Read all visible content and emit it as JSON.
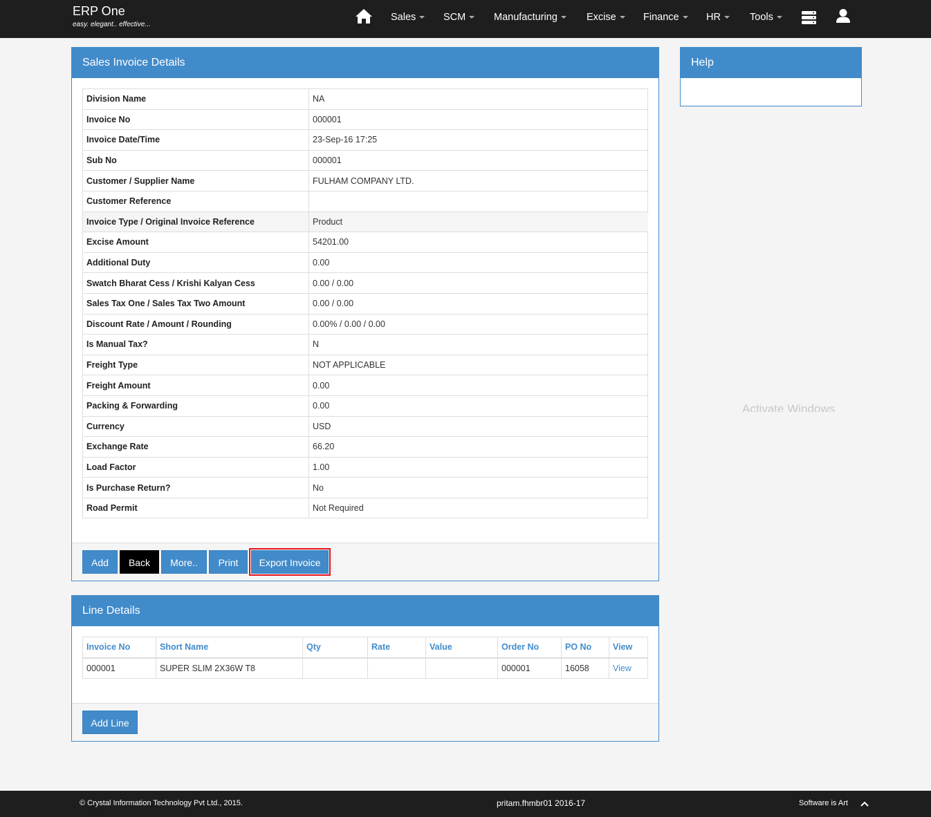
{
  "brand": {
    "title": "ERP One",
    "tagline": "easy. elegant.. effective..."
  },
  "nav": {
    "items": [
      {
        "label": "Sales"
      },
      {
        "label": "SCM"
      },
      {
        "label": "Manufacturing"
      },
      {
        "label": "Excise"
      },
      {
        "label": "Finance"
      },
      {
        "label": "HR"
      },
      {
        "label": "Tools"
      }
    ],
    "icons": [
      "home-icon",
      "server-icon",
      "user-icon"
    ]
  },
  "invoice_panel": {
    "title": "Sales Invoice Details",
    "rows": [
      {
        "label": "Division Name",
        "value": "NA"
      },
      {
        "label": "Invoice No",
        "value": "000001"
      },
      {
        "label": "Invoice Date/Time",
        "value": "23-Sep-16 17:25"
      },
      {
        "label": "Sub No",
        "value": "000001"
      },
      {
        "label": "Customer / Supplier Name",
        "value": "FULHAM COMPANY LTD."
      },
      {
        "label": "Customer Reference",
        "value": ""
      },
      {
        "label": "Invoice Type / Original Invoice Reference",
        "value": "Product"
      },
      {
        "label": "Excise Amount",
        "value": "54201.00"
      },
      {
        "label": "Additional Duty",
        "value": "0.00"
      },
      {
        "label": "Swatch Bharat Cess / Krishi Kalyan Cess",
        "value": "0.00 / 0.00"
      },
      {
        "label": "Sales Tax One / Sales Tax Two Amount",
        "value": "0.00 / 0.00"
      },
      {
        "label": "Discount Rate / Amount / Rounding",
        "value": "0.00% / 0.00 / 0.00"
      },
      {
        "label": "Is Manual Tax?",
        "value": "N"
      },
      {
        "label": "Freight Type",
        "value": "NOT APPLICABLE"
      },
      {
        "label": "Freight Amount",
        "value": "0.00"
      },
      {
        "label": "Packing & Forwarding",
        "value": "0.00"
      },
      {
        "label": "Currency",
        "value": "USD"
      },
      {
        "label": "Exchange Rate",
        "value": "66.20"
      },
      {
        "label": "Load Factor",
        "value": "1.00"
      },
      {
        "label": "Is Purchase Return?",
        "value": "No"
      },
      {
        "label": "Road Permit",
        "value": "Not Required"
      }
    ],
    "buttons": {
      "add": "Add",
      "back": "Back",
      "more": "More..",
      "print": "Print",
      "export": "Export Invoice"
    }
  },
  "help_panel": {
    "title": "Help"
  },
  "line_panel": {
    "title": "Line Details",
    "columns": [
      "Invoice No",
      "Short Name",
      "Qty",
      "Rate",
      "Value",
      "Order No",
      "PO No",
      "View"
    ],
    "rows": [
      {
        "invoice_no": "000001",
        "short_name": "SUPER SLIM 2X36W T8",
        "qty": "",
        "rate": "",
        "value": "",
        "order_no": "000001",
        "po_no": "16058",
        "view": "View"
      }
    ],
    "add_line": "Add Line"
  },
  "watermark": "Activate Windows",
  "footer": {
    "copyright": "© Crystal Information Technology Pvt Ltd., 2015.",
    "session": "pritam.fhmbr01 2016-17",
    "motto": "Software is Art"
  },
  "colors": {
    "primary": "#428bca",
    "navbar": "#1e1e1e",
    "highlight": "#e8111b",
    "background": "#f4f4f4"
  }
}
